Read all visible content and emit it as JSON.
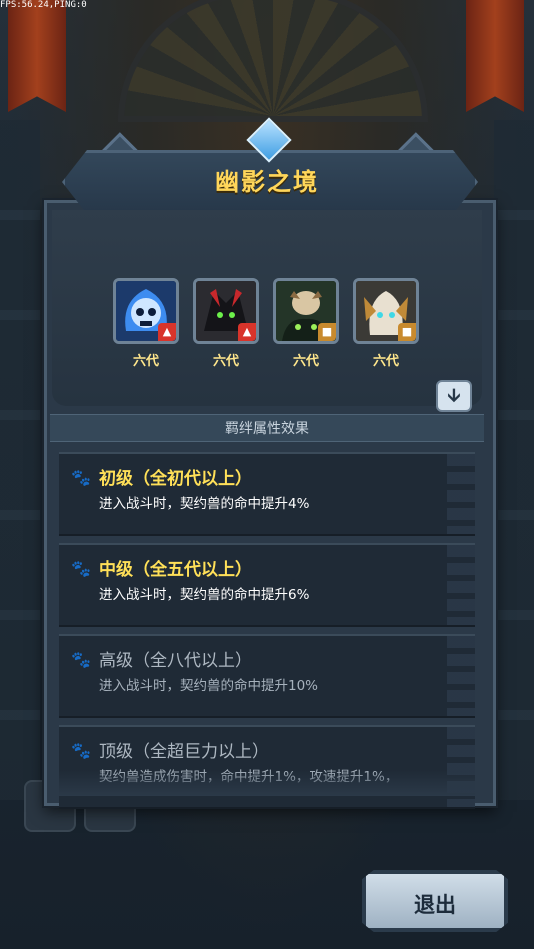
{
  "fps_text": "FPS:56.24,PING:0",
  "dialog": {
    "title": "幽影之境",
    "section_title": "羁绊属性效果",
    "exit_label": "退出"
  },
  "pets": [
    {
      "name": "blue-skull-pet",
      "generation": "六代",
      "element": "fire",
      "tag_color": "#d8342b"
    },
    {
      "name": "black-dragon-pet",
      "generation": "六代",
      "element": "fire",
      "tag_color": "#d8342b"
    },
    {
      "name": "owl-forest-pet",
      "generation": "六代",
      "element": "earth",
      "tag_color": "#c88a2e"
    },
    {
      "name": "white-mask-pet",
      "generation": "六代",
      "element": "earth",
      "tag_color": "#c88a2e"
    }
  ],
  "bond_effects": [
    {
      "level": "初级（全初代以上）",
      "description": "进入战斗时，契约兽的命中提升4%",
      "active": true
    },
    {
      "level": "中级（全五代以上）",
      "description": "进入战斗时，契约兽的命中提升6%",
      "active": true
    },
    {
      "level": "高级（全八代以上）",
      "description": "进入战斗时，契约兽的命中提升10%",
      "active": false
    },
    {
      "level": "顶级（全超巨力以上）",
      "description": "契约兽造成伤害时，命中提升1%，攻速提升1%，",
      "active": false
    }
  ],
  "colors": {
    "active_text": "#ffe058",
    "title": "#ffd65a",
    "panel": "#2b3948"
  }
}
